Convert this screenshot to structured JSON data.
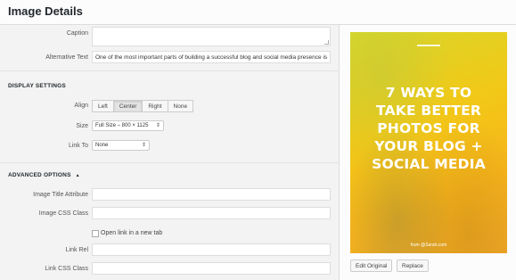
{
  "header": {
    "title": "Image Details"
  },
  "caption": {
    "label": "Caption",
    "value": ""
  },
  "alt_text": {
    "label": "Alternative Text",
    "value": "One of the most important parts of building a successful blog and social media presence is"
  },
  "display_settings": {
    "title": "DISPLAY SETTINGS",
    "align": {
      "label": "Align",
      "options": [
        "Left",
        "Center",
        "Right",
        "None"
      ],
      "selected": "Center"
    },
    "size": {
      "label": "Size",
      "value": "Full Size – 800 × 1125"
    },
    "link_to": {
      "label": "Link To",
      "value": "None"
    }
  },
  "advanced_options": {
    "title": "ADVANCED OPTIONS",
    "toggle_glyph": "▲",
    "image_title_attribute": {
      "label": "Image Title Attribute",
      "value": ""
    },
    "image_css_class": {
      "label": "Image CSS Class",
      "value": ""
    },
    "open_new_tab": {
      "label": "Open link in a new tab",
      "checked": false
    },
    "link_rel": {
      "label": "Link Rel",
      "value": ""
    },
    "link_css_class": {
      "label": "Link CSS Class",
      "value": ""
    }
  },
  "preview": {
    "headline_lines": [
      "7 WAYS TO",
      "TAKE BETTER",
      "PHOTOS FOR",
      "YOUR BLOG +",
      "SOCIAL MEDIA"
    ],
    "from_text": "from @Sarah.com"
  },
  "buttons": {
    "edit_original": "Edit Original",
    "replace": "Replace"
  },
  "icons": {
    "select_arrow": "select-arrows-icon",
    "collapse": "triangle-up-icon"
  }
}
